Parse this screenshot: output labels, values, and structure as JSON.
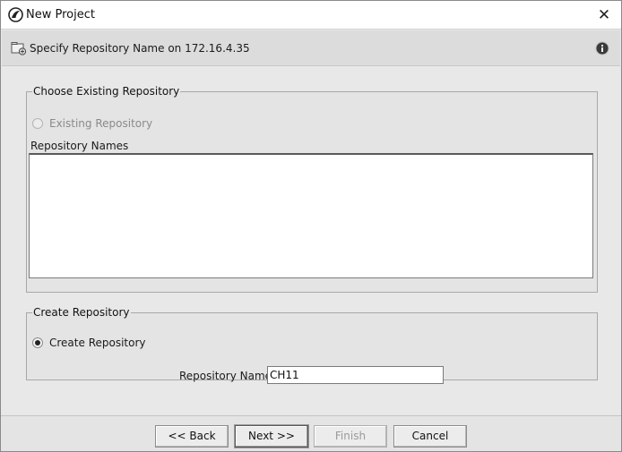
{
  "window": {
    "title": "New Project",
    "close_glyph": "✕"
  },
  "header": {
    "text": "Specify Repository Name on 172.16.4.35",
    "icon": "folder-server-icon",
    "info_icon": "info-icon"
  },
  "existing_group": {
    "legend": "Choose Existing Repository",
    "radio_label": "Existing Repository",
    "radio_selected": false,
    "radio_enabled": false,
    "list_label": "Repository Names",
    "repository_names": []
  },
  "create_group": {
    "legend": "Create Repository",
    "radio_label": "Create Repository",
    "radio_selected": true,
    "name_label": "Repository Name:",
    "name_value": "CH11"
  },
  "buttons": {
    "back": "<< Back",
    "next": "Next >>",
    "finish": "Finish",
    "cancel": "Cancel"
  },
  "colors": {
    "background": "#e8e8e8",
    "titlebar": "#ffffff",
    "header": "#dcdcdc"
  }
}
